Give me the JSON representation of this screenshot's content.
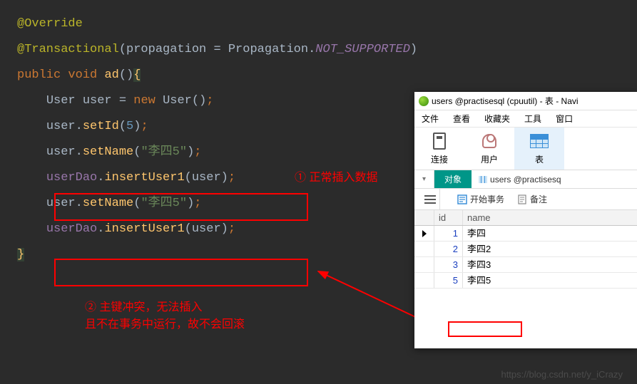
{
  "code": {
    "ann1": "@Override",
    "ann2": "@Transactional",
    "prop_kw": "propagation",
    "eq": " = ",
    "prop_cls": "Propagation",
    "prop_val": "NOT_SUPPORTED",
    "public": "public",
    "void": "void",
    "ad": "ad",
    "lbrace": "{",
    "rbrace": "}",
    "User": "User",
    "user": "user",
    "newkw": "new",
    "setId": "setId",
    "five": "5",
    "setName": "setName",
    "strLi": "\"李四5\"",
    "userDao": "userDao",
    "insertUser1": "insertUser1"
  },
  "notes": {
    "n1": "① 正常插入数据",
    "n2a": "② 主键冲突，无法插入",
    "n2b": "    且不在事务中运行，故不会回滚"
  },
  "nav": {
    "title": "users @practisesql (cpuutil) - 表 - Navi",
    "menu": {
      "file": "文件",
      "view": "查看",
      "fav": "收藏夹",
      "tool": "工具",
      "window": "窗口"
    },
    "toolbar": {
      "conn": "连接",
      "user": "用户",
      "table": "表"
    },
    "tabs": {
      "obj": "对象",
      "users": "users @practisesq"
    },
    "sub": {
      "begin": "开始事务",
      "memo": "备注"
    },
    "grid": {
      "cols": {
        "id": "id",
        "name": "name"
      },
      "rows": [
        {
          "id": "1",
          "name": "李四",
          "cur": true
        },
        {
          "id": "2",
          "name": "李四2",
          "cur": false
        },
        {
          "id": "3",
          "name": "李四3",
          "cur": false
        },
        {
          "id": "5",
          "name": "李四5",
          "cur": false
        }
      ]
    }
  },
  "watermark": "https://blog.csdn.net/y_iCrazy"
}
